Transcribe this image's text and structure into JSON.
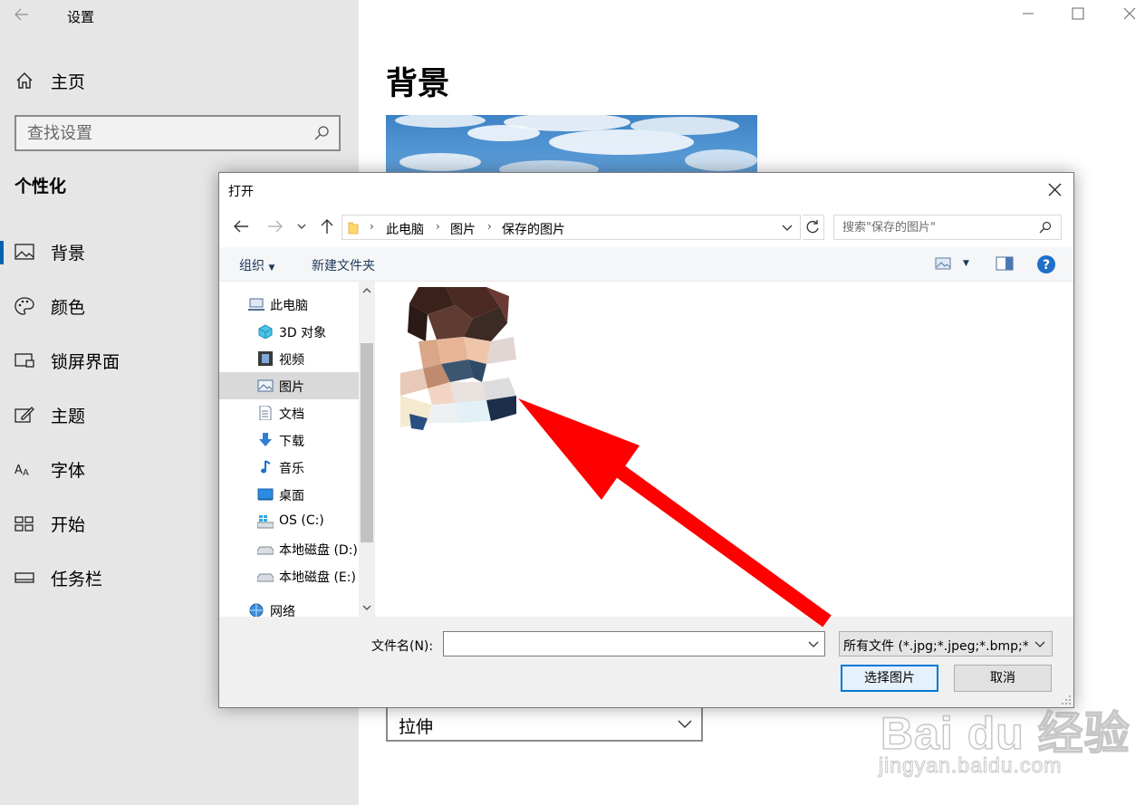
{
  "settings": {
    "app_title": "设置",
    "home_label": "主页",
    "search_placeholder": "查找设置",
    "section_title": "个性化",
    "nav": [
      {
        "label": "背景",
        "icon": "image-icon"
      },
      {
        "label": "颜色",
        "icon": "palette-icon"
      },
      {
        "label": "锁屏界面",
        "icon": "lock-screen-icon"
      },
      {
        "label": "主题",
        "icon": "theme-icon"
      },
      {
        "label": "字体",
        "icon": "font-icon"
      },
      {
        "label": "开始",
        "icon": "start-icon"
      },
      {
        "label": "任务栏",
        "icon": "taskbar-icon"
      }
    ],
    "page_title": "背景",
    "fit_value": "拉伸"
  },
  "dialog": {
    "title": "打开",
    "breadcrumb": [
      "此电脑",
      "图片",
      "保存的图片"
    ],
    "search_placeholder": "搜索\"保存的图片\"",
    "toolbar": {
      "organize": "组织",
      "new_folder": "新建文件夹"
    },
    "tree": [
      {
        "label": "此电脑",
        "icon": "computer-icon"
      },
      {
        "label": "3D 对象",
        "icon": "cube-icon"
      },
      {
        "label": "视频",
        "icon": "film-icon"
      },
      {
        "label": "图片",
        "icon": "pictures-icon"
      },
      {
        "label": "文档",
        "icon": "document-icon"
      },
      {
        "label": "下载",
        "icon": "download-icon"
      },
      {
        "label": "音乐",
        "icon": "music-icon"
      },
      {
        "label": "桌面",
        "icon": "desktop-icon"
      },
      {
        "label": "OS (C:)",
        "icon": "windows-drive-icon"
      },
      {
        "label": "本地磁盘 (D:)",
        "icon": "drive-icon"
      },
      {
        "label": "本地磁盘 (E:)",
        "icon": "drive-icon"
      },
      {
        "label": "网络",
        "icon": "network-icon"
      }
    ],
    "filename_label": "文件名(N):",
    "filename_value": "",
    "filetype_value": "所有文件 (*.jpg;*.jpeg;*.bmp;*",
    "open_button": "选择图片",
    "cancel_button": "取消"
  },
  "watermark": {
    "main": "Bai du 经验",
    "sub": "jingyan.baidu.com"
  },
  "colors": {
    "accent": "#0063b1",
    "annotation_arrow": "#ff0000",
    "sidebar_bg": "#e6e6e6"
  }
}
